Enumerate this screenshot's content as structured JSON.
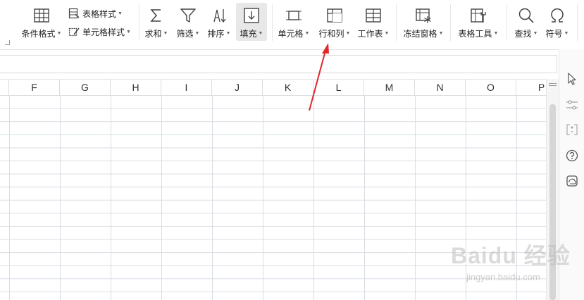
{
  "ribbon": {
    "conditional_format": "条件格式",
    "table_style": "表格样式",
    "cell_style": "单元格样式",
    "sum": "求和",
    "filter": "筛选",
    "sort": "排序",
    "fill": "填充",
    "cell": "单元格",
    "row_col": "行和列",
    "worksheet": "工作表",
    "freeze": "冻结窗格",
    "table_tools": "表格工具",
    "find": "查找",
    "symbol": "符号"
  },
  "columns": [
    "F",
    "G",
    "H",
    "I",
    "J",
    "K",
    "L",
    "M",
    "N",
    "O",
    "P"
  ],
  "watermark": {
    "brand": "Baidu 经验",
    "url": "jingyan.baidu.com"
  },
  "colors": {
    "annotation_arrow": "#e0282e",
    "grid_line": "#d9dde3"
  },
  "icons": [
    "table-icon",
    "table-style-icon",
    "cell-style-icon",
    "sigma-icon",
    "filter-icon",
    "sort-icon",
    "fill-down-icon",
    "cell-icon",
    "row-col-icon",
    "worksheet-icon",
    "freeze-icon",
    "table-tools-icon",
    "search-icon",
    "omega-icon",
    "cursor-icon",
    "settings-sliders-icon",
    "transfer-icon",
    "help-icon",
    "backup-icon"
  ]
}
